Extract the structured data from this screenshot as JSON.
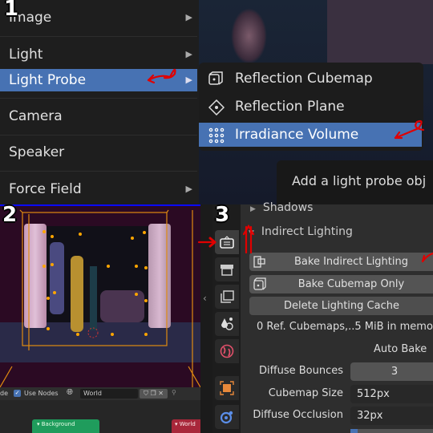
{
  "panel_labels": [
    "1",
    "2",
    "3"
  ],
  "add_menu": {
    "items": [
      {
        "label": "Image",
        "submenu": true
      },
      {
        "label": "Light",
        "submenu": true
      },
      {
        "label": "Light Probe",
        "submenu": true,
        "highlighted": true
      },
      {
        "label": "Camera",
        "submenu": false
      },
      {
        "label": "Speaker",
        "submenu": false
      },
      {
        "label": "Force Field",
        "submenu": true
      }
    ],
    "arrow_glyph": "▶"
  },
  "light_probe_submenu": {
    "items": [
      {
        "label": "Reflection Cubemap",
        "icon": "cube-icon"
      },
      {
        "label": "Reflection Plane",
        "icon": "diamond-icon"
      },
      {
        "label": "Irradiance Volume",
        "icon": "grid-dots-icon",
        "highlighted": true
      }
    ]
  },
  "tooltip": {
    "text": "Add a light probe obj"
  },
  "world_header": {
    "partial_label": "de",
    "use_nodes_label": "Use Nodes",
    "use_nodes_checked": true,
    "world_name": "World"
  },
  "node_editor": {
    "nodes": [
      {
        "label": "Background",
        "color": "#1f9c5c"
      },
      {
        "label": "World",
        "color": "#a8273a"
      }
    ]
  },
  "properties": {
    "sections": [
      {
        "label": "Shadows",
        "expanded": false
      },
      {
        "label": "Indirect Lighting",
        "expanded": true
      }
    ],
    "buttons": [
      "Bake Indirect Lighting",
      "Bake Cubemap Only",
      "Delete Lighting Cache"
    ],
    "info": "0 Ref. Cubemaps,..5 MiB in memo",
    "auto_bake_label": "Auto Bake",
    "fields": [
      {
        "label": "Diffuse Bounces",
        "value": "3"
      },
      {
        "label": "Cubemap Size",
        "value": "512px"
      },
      {
        "label": "Diffuse Occlusion",
        "value": "32px"
      }
    ]
  },
  "colors": {
    "highlight": "#4772b3",
    "annotation": "#e00000"
  }
}
